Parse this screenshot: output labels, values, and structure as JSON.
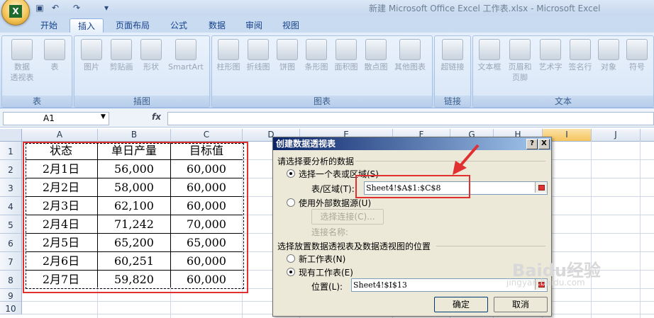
{
  "window": {
    "title": "新建 Microsoft Office Excel 工作表.xlsx - Microsoft Excel",
    "quick_access": [
      "save-icon",
      "undo-icon",
      "redo-icon",
      "customize-icon"
    ]
  },
  "ribbon": {
    "tabs": [
      "开始",
      "插入",
      "页面布局",
      "公式",
      "数据",
      "审阅",
      "视图"
    ],
    "active_tab": "插入",
    "groups": [
      {
        "label": "表",
        "buttons": [
          {
            "line1": "数据",
            "line2": "透视表"
          },
          {
            "line1": "表",
            "line2": ""
          }
        ]
      },
      {
        "label": "插图",
        "buttons": [
          {
            "line1": "图片",
            "line2": ""
          },
          {
            "line1": "剪贴画",
            "line2": ""
          },
          {
            "line1": "形状",
            "line2": ""
          },
          {
            "line1": "SmartArt",
            "line2": ""
          }
        ]
      },
      {
        "label": "图表",
        "buttons": [
          {
            "line1": "柱形图",
            "line2": ""
          },
          {
            "line1": "折线图",
            "line2": ""
          },
          {
            "line1": "饼图",
            "line2": ""
          },
          {
            "line1": "条形图",
            "line2": ""
          },
          {
            "line1": "面积图",
            "line2": ""
          },
          {
            "line1": "散点图",
            "line2": ""
          },
          {
            "line1": "其他图表",
            "line2": ""
          }
        ]
      },
      {
        "label": "链接",
        "buttons": [
          {
            "line1": "超链接",
            "line2": ""
          }
        ]
      },
      {
        "label": "文本",
        "buttons": [
          {
            "line1": "文本框",
            "line2": ""
          },
          {
            "line1": "页眉和",
            "line2": "页脚"
          },
          {
            "line1": "艺术字",
            "line2": ""
          },
          {
            "line1": "签名行",
            "line2": ""
          },
          {
            "line1": "对象",
            "line2": ""
          },
          {
            "line1": "符号",
            "line2": ""
          }
        ]
      }
    ]
  },
  "formula_bar": {
    "name_box": "A1",
    "fx": "fx",
    "formula": ""
  },
  "sheet": {
    "columns": [
      "A",
      "B",
      "C",
      "D",
      "E",
      "F",
      "G",
      "H",
      "I",
      "J"
    ],
    "selected_column": "I",
    "rows": [
      "1",
      "2",
      "3",
      "4",
      "5",
      "6",
      "7",
      "8",
      "9",
      "10"
    ],
    "table": [
      [
        "状态",
        "单日产量",
        "目标值"
      ],
      [
        "2月1日",
        "56,000",
        "60,000"
      ],
      [
        "2月2日",
        "58,000",
        "60,000"
      ],
      [
        "2月3日",
        "62,100",
        "60,000"
      ],
      [
        "2月4日",
        "71,242",
        "70,000"
      ],
      [
        "2月5日",
        "65,200",
        "65,000"
      ],
      [
        "2月6日",
        "60,251",
        "60,000"
      ],
      [
        "2月7日",
        "59,820",
        "60,000"
      ]
    ]
  },
  "dialog": {
    "title": "创建数据透视表",
    "help": "?",
    "close": "X",
    "section1": "请选择要分析的数据",
    "opt_range": "选择一个表或区域(S)",
    "range_label": "表/区域(T):",
    "range_value": "Sheet4!$A$1:$C$8",
    "opt_external": "使用外部数据源(U)",
    "choose_connection": "选择连接(C)...",
    "connection_name": "连接名称:",
    "section2": "选择放置数据透视表及数据透视图的位置",
    "opt_new_sheet": "新工作表(N)",
    "opt_existing_sheet": "现有工作表(E)",
    "location_label": "位置(L):",
    "location_value": "Sheet4!$I$13",
    "ok": "确定",
    "cancel": "取消"
  },
  "watermark": {
    "line1": "Baidu经验",
    "line2": "jingyan.baidu.com"
  },
  "colors": {
    "highlight": "#e03030",
    "ribbon": "#cfe0f5",
    "dialog_title": "#0a246a"
  }
}
